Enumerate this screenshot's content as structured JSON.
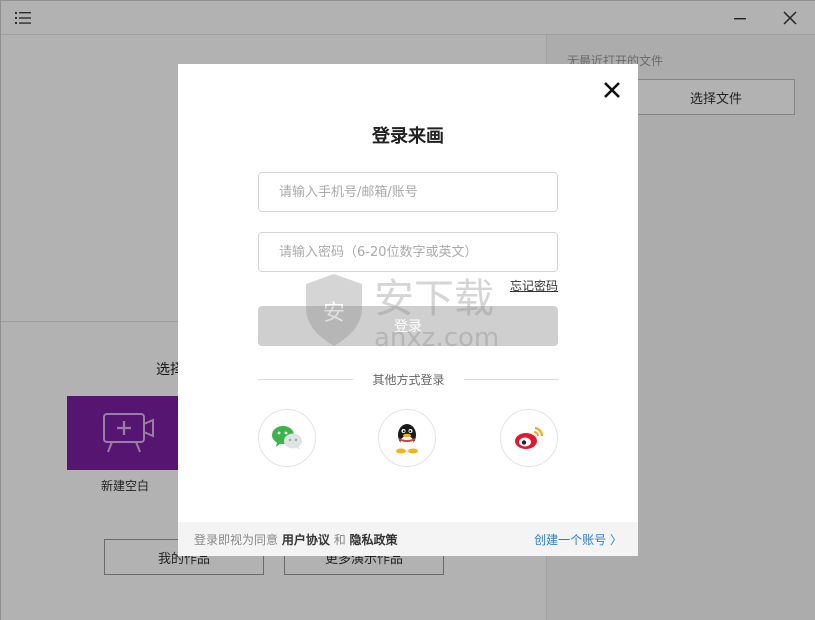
{
  "app": {
    "recent_label": "无最近打开的文件",
    "choose_file_label": "选择文件",
    "select_title": "选择",
    "new_blank_label": "新建空白",
    "my_works_label": "我的作品",
    "more_works_label": "更多演示作品",
    "tile_color": "#7b1fa2"
  },
  "login": {
    "title": "登录来画",
    "phone_placeholder": "请输入手机号/邮箱/账号",
    "password_placeholder": "请输入密码（6-20位数字或英文）",
    "forgot_label": "忘记密码",
    "login_label": "登录",
    "other_methods_label": "其他方式登录",
    "social_icons": [
      "wechat-icon",
      "qq-icon",
      "weibo-icon"
    ],
    "footer": {
      "prefix": "登录即视为同意",
      "terms": "用户协议",
      "and": "和",
      "privacy": "隐私政策",
      "create_account": "创建一个账号 〉"
    }
  },
  "watermark": {
    "text": "安下载",
    "subtext": "anxz.com"
  },
  "colors": {
    "link_blue": "#2a7fd4",
    "login_disabled": "#cfcfcf",
    "overlay": "rgba(0,0,0,0.3)"
  }
}
